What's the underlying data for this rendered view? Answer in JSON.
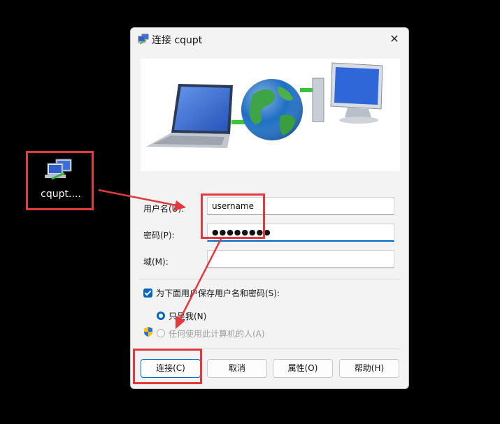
{
  "desktop": {
    "shortcut_label": "cqupt...."
  },
  "dialog": {
    "title": "连接 cqupt",
    "close_glyph": "✕",
    "fields": {
      "user_label": "用户名(U):",
      "user_value": "username",
      "password_label": "密码(P):",
      "password_value": "●●●●●●●●",
      "domain_label": "域(M):",
      "domain_value": ""
    },
    "save_checkbox": {
      "label": "为下面用户保存用户名和密码(S):",
      "checked": true
    },
    "radio_options": [
      {
        "label": "只是我(N)",
        "selected": true
      },
      {
        "label": "任何使用此计算机的人(A)",
        "selected": false,
        "disabled": true
      }
    ],
    "buttons": {
      "connect": "连接(C)",
      "cancel": "取消",
      "properties": "属性(O)",
      "help": "帮助(H)"
    }
  },
  "colors": {
    "annotation_red": "#e03a3f",
    "accent": "#0067c0"
  },
  "icons": [
    "network-connection-icon",
    "close-icon",
    "uac-shield-icon"
  ]
}
